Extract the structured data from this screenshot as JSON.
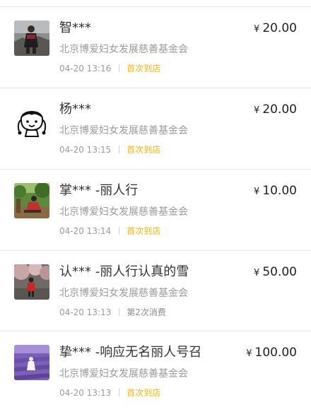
{
  "donations": [
    {
      "name": "智***",
      "amount": "20.00",
      "currency": "¥",
      "org": "北京博爱妇女发展慈善基金会",
      "time": "04-20 13:16",
      "tag": "首次到店",
      "tag_type": "first",
      "avatar": "photo-avatar-person-on-rocks"
    },
    {
      "name": "杨***",
      "amount": "20.00",
      "currency": "¥",
      "org": "北京博爱妇女发展慈善基金会",
      "time": "04-20 13:15",
      "tag": "首次到店",
      "tag_type": "first",
      "avatar": "cartoon-girl-avatar"
    },
    {
      "name": "掌*** -丽人行",
      "amount": "10.00",
      "currency": "¥",
      "org": "北京博爱妇女发展慈善基金会",
      "time": "04-20 13:14",
      "tag": "首次到店",
      "tag_type": "first",
      "avatar": "photo-avatar-woman-in-garden"
    },
    {
      "name": "认*** -丽人行认真的雪",
      "amount": "50.00",
      "currency": "¥",
      "org": "北京博爱妇女发展慈善基金会",
      "time": "04-20 13:13",
      "tag": "第2次消费",
      "tag_type": "nth",
      "avatar": "photo-avatar-person-under-blossoms"
    },
    {
      "name": "挚*** -响应无名丽人号召",
      "amount": "100.00",
      "currency": "¥",
      "org": "北京博爱妇女发展慈善基金会",
      "time": "04-20 13:13",
      "tag": "首次到店",
      "tag_type": "first",
      "avatar": "photo-avatar-lavender-field"
    }
  ],
  "colors": {
    "tag_first": "#f0b400",
    "tag_nth": "#8a8a8a",
    "secondary_text": "#9a9a9a",
    "separator": "#e6e6e6"
  }
}
